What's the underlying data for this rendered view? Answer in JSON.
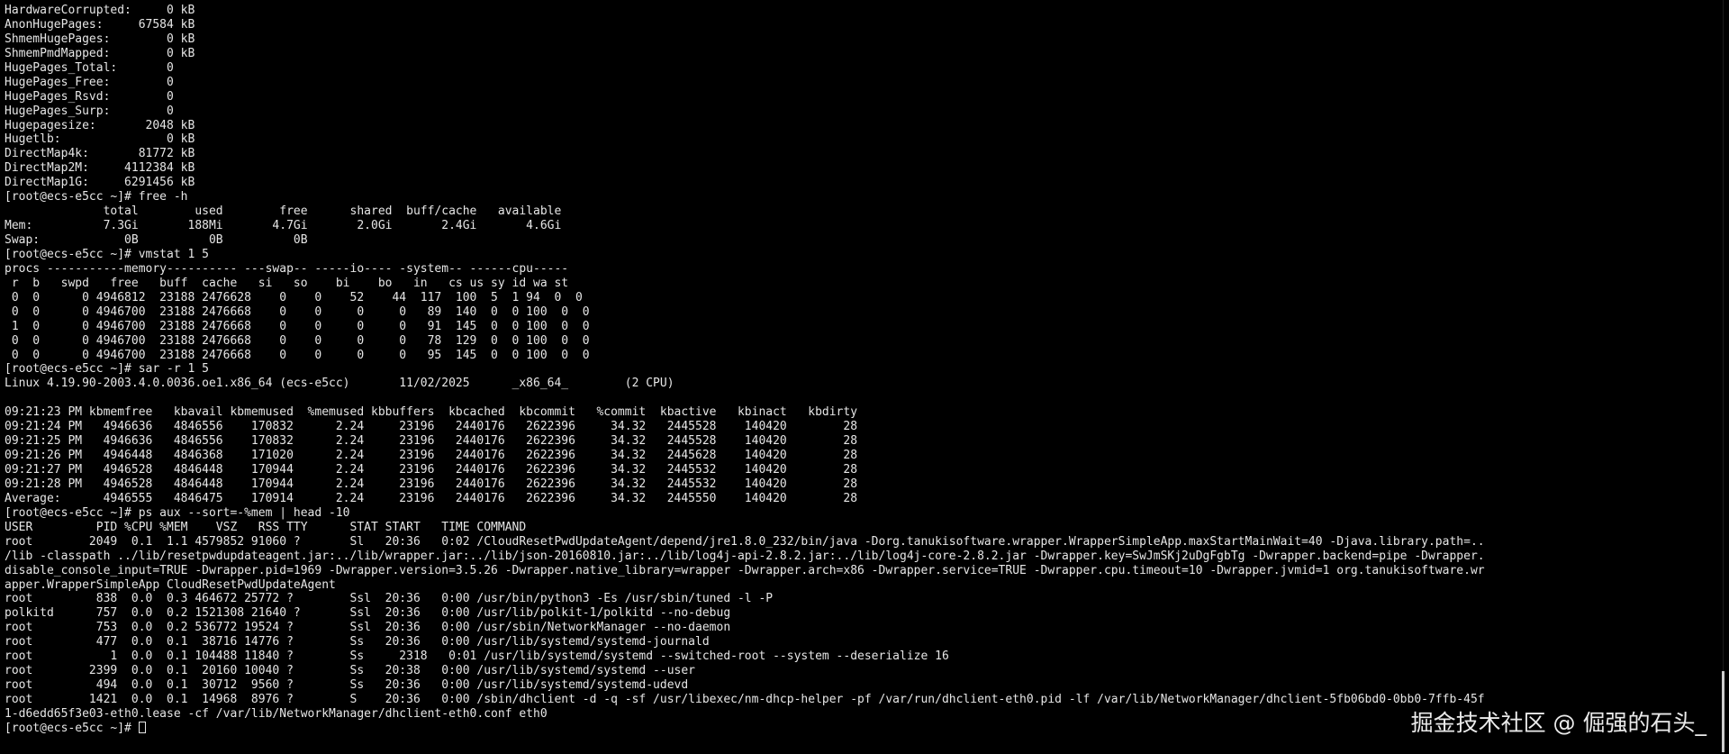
{
  "terminal": {
    "lines": [
      "HardwareCorrupted:     0 kB",
      "AnonHugePages:     67584 kB",
      "ShmemHugePages:        0 kB",
      "ShmemPmdMapped:        0 kB",
      "HugePages_Total:       0",
      "HugePages_Free:        0",
      "HugePages_Rsvd:        0",
      "HugePages_Surp:        0",
      "Hugepagesize:       2048 kB",
      "Hugetlb:               0 kB",
      "DirectMap4k:       81772 kB",
      "DirectMap2M:     4112384 kB",
      "DirectMap1G:     6291456 kB",
      "[root@ecs-e5cc ~]# free -h",
      "              total        used        free      shared  buff/cache   available",
      "Mem:          7.3Gi       188Mi       4.7Gi       2.0Gi       2.4Gi       4.6Gi",
      "Swap:            0B          0B          0B",
      "[root@ecs-e5cc ~]# vmstat 1 5",
      "procs -----------memory---------- ---swap-- -----io---- -system-- ------cpu-----",
      " r  b   swpd   free   buff  cache   si   so    bi    bo   in   cs us sy id wa st",
      " 0  0      0 4946812  23188 2476628    0    0    52    44  117  100  5  1 94  0  0",
      " 0  0      0 4946700  23188 2476668    0    0     0     0   89  140  0  0 100  0  0",
      " 1  0      0 4946700  23188 2476668    0    0     0     0   91  145  0  0 100  0  0",
      " 0  0      0 4946700  23188 2476668    0    0     0     0   78  129  0  0 100  0  0",
      " 0  0      0 4946700  23188 2476668    0    0     0     0   95  145  0  0 100  0  0",
      "[root@ecs-e5cc ~]# sar -r 1 5",
      "Linux 4.19.90-2003.4.0.0036.oe1.x86_64 (ecs-e5cc)       11/02/2025      _x86_64_        (2 CPU)",
      "",
      "09:21:23 PM kbmemfree   kbavail kbmemused  %memused kbbuffers  kbcached  kbcommit   %commit  kbactive   kbinact   kbdirty",
      "09:21:24 PM   4946636   4846556    170832      2.24     23196   2440176   2622396     34.32   2445528    140420        28",
      "09:21:25 PM   4946636   4846556    170832      2.24     23196   2440176   2622396     34.32   2445528    140420        28",
      "09:21:26 PM   4946448   4846368    171020      2.24     23196   2440176   2622396     34.32   2445628    140420        28",
      "09:21:27 PM   4946528   4846448    170944      2.24     23196   2440176   2622396     34.32   2445532    140420        28",
      "09:21:28 PM   4946528   4846448    170944      2.24     23196   2440176   2622396     34.32   2445532    140420        28",
      "Average:      4946555   4846475    170914      2.24     23196   2440176   2622396     34.32   2445550    140420        28",
      "[root@ecs-e5cc ~]# ps aux --sort=-%mem | head -10",
      "USER         PID %CPU %MEM    VSZ   RSS TTY      STAT START   TIME COMMAND",
      "root        2049  0.1  1.1 4579852 91060 ?       Sl   20:36   0:02 /CloudResetPwdUpdateAgent/depend/jre1.8.0_232/bin/java -Dorg.tanukisoftware.wrapper.WrapperSimpleApp.maxStartMainWait=40 -Djava.library.path=..",
      "/lib -classpath ../lib/resetpwdupdateagent.jar:../lib/wrapper.jar:../lib/json-20160810.jar:../lib/log4j-api-2.8.2.jar:../lib/log4j-core-2.8.2.jar -Dwrapper.key=SwJmSKj2uDgFgbTg -Dwrapper.backend=pipe -Dwrapper.",
      "disable_console_input=TRUE -Dwrapper.pid=1969 -Dwrapper.version=3.5.26 -Dwrapper.native_library=wrapper -Dwrapper.arch=x86 -Dwrapper.service=TRUE -Dwrapper.cpu.timeout=10 -Dwrapper.jvmid=1 org.tanukisoftware.wr",
      "apper.WrapperSimpleApp CloudResetPwdUpdateAgent",
      "root         838  0.0  0.3 464672 25772 ?        Ssl  20:36   0:00 /usr/bin/python3 -Es /usr/sbin/tuned -l -P",
      "polkitd      757  0.0  0.2 1521308 21640 ?       Ssl  20:36   0:00 /usr/lib/polkit-1/polkitd --no-debug",
      "root         753  0.0  0.2 536772 19524 ?        Ssl  20:36   0:00 /usr/sbin/NetworkManager --no-daemon",
      "root         477  0.0  0.1  38716 14776 ?        Ss   20:36   0:00 /usr/lib/systemd/systemd-journald",
      "root           1  0.0  0.1 104488 11840 ?        Ss     2318   0:01 /usr/lib/systemd/systemd --switched-root --system --deserialize 16",
      "root        2399  0.0  0.1  20160 10040 ?        Ss   20:38   0:00 /usr/lib/systemd/systemd --user",
      "root         494  0.0  0.1  30712  9560 ?        Ss   20:36   0:00 /usr/lib/systemd/systemd-udevd",
      "root        1421  0.0  0.1  14968  8976 ?        S    20:36   0:00 /sbin/dhclient -d -q -sf /usr/libexec/nm-dhcp-helper -pf /var/run/dhclient-eth0.pid -lf /var/lib/NetworkManager/dhclient-5fb06bd0-0bb0-7ffb-45f",
      "1-d6edd65f3e03-eth0.lease -cf /var/lib/NetworkManager/dhclient-eth0.conf eth0"
    ],
    "prompt": "[root@ecs-e5cc ~]# "
  },
  "watermark": {
    "text": "掘金技术社区 @ 倔强的石头_"
  },
  "colors": {
    "background": "#000000",
    "foreground": "#e6e6e6",
    "watermark": "#ffffff"
  }
}
